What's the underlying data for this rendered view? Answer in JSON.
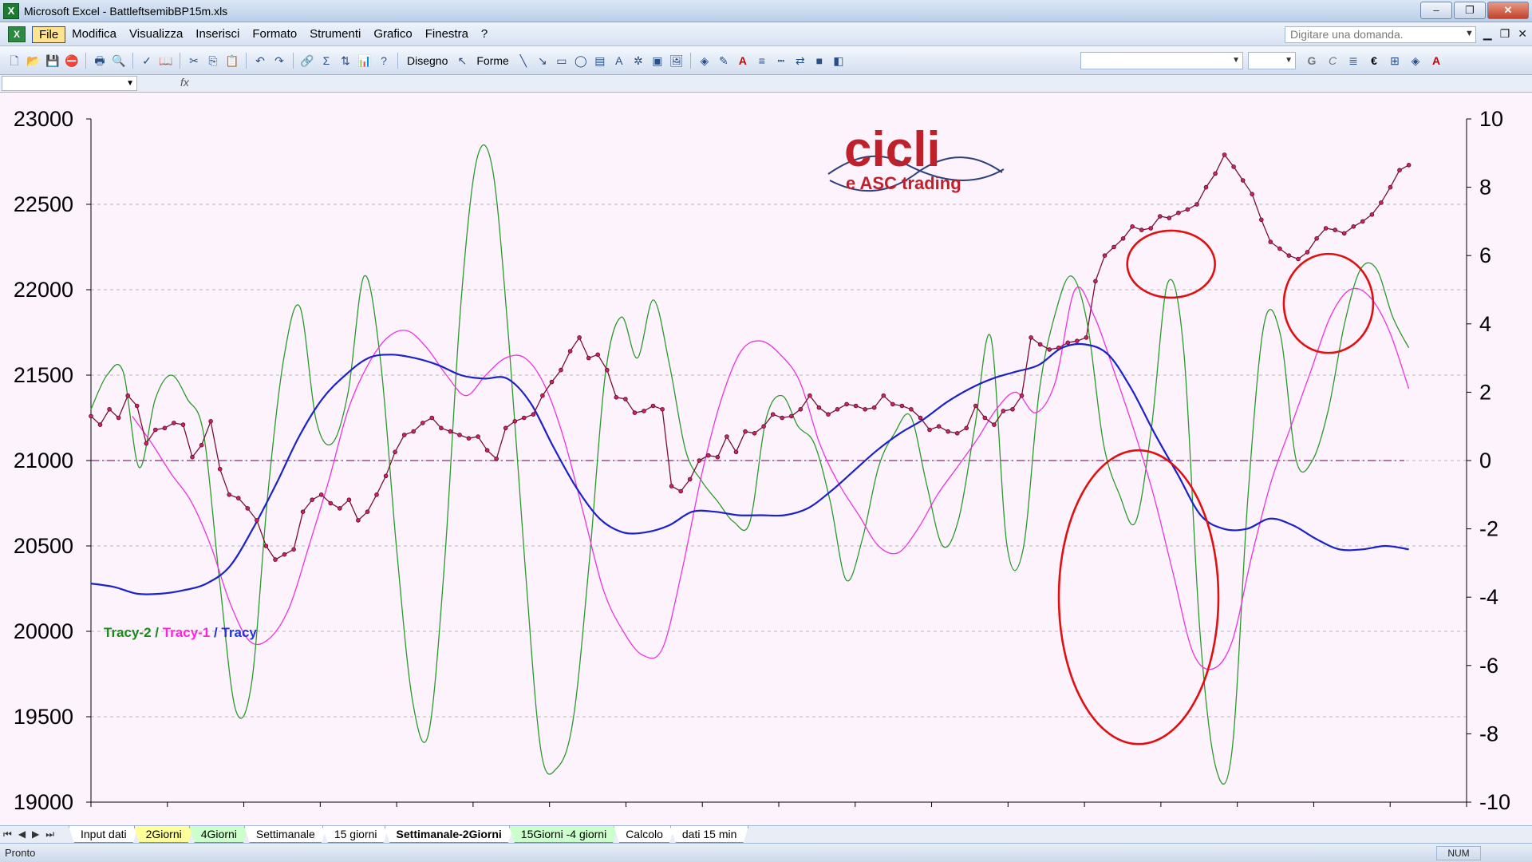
{
  "window": {
    "title": "Microsoft Excel - BattleftsemibBP15m.xls",
    "buttons": [
      "–",
      "❐",
      "✕"
    ]
  },
  "menu": {
    "items": [
      "File",
      "Modifica",
      "Visualizza",
      "Inserisci",
      "Formato",
      "Strumenti",
      "Grafico",
      "Finestra",
      "?"
    ],
    "help_placeholder": "Digitare una domanda."
  },
  "toolbar": {
    "disegno_label": "Disegno",
    "forme_label": "Forme",
    "bold": "G",
    "italic": "C",
    "euro": "€"
  },
  "formula": {
    "fx": "fx"
  },
  "logo": {
    "main": "cicli",
    "sub": "e ASC trading"
  },
  "chart_data": {
    "type": "line",
    "left_axis": {
      "ticks": [
        23000,
        22500,
        22000,
        21500,
        21000,
        20500,
        20000,
        19500,
        19000
      ],
      "ylim": [
        19000,
        23000
      ]
    },
    "right_axis": {
      "ticks": [
        10,
        8,
        6,
        4,
        2,
        0,
        -2,
        -4,
        -6,
        -8,
        -10
      ],
      "ylim": [
        -10,
        10
      ]
    },
    "legend": {
      "parts": [
        {
          "text": "Tracy-2",
          "color": "#1a8a1a"
        },
        {
          "text": " / ",
          "color": "#1a8a1a"
        },
        {
          "text": "Tracy-1",
          "color": "#ff22dd"
        },
        {
          "text": " / ",
          "color": "#2233dd"
        },
        {
          "text": "Tracy",
          "color": "#2233dd"
        }
      ]
    },
    "series": [
      {
        "name": "Price",
        "axis": "left",
        "color": "#7a1030",
        "marker_color": "#cc2266",
        "values": [
          21260,
          21210,
          21300,
          21250,
          21380,
          21320,
          21100,
          21180,
          21190,
          21220,
          21210,
          21020,
          21090,
          21230,
          20950,
          20800,
          20780,
          20720,
          20650,
          20500,
          20420,
          20450,
          20480,
          20700,
          20770,
          20800,
          20750,
          20720,
          20770,
          20650,
          20700,
          20800,
          20910,
          21050,
          21150,
          21170,
          21220,
          21250,
          21190,
          21170,
          21150,
          21130,
          21140,
          21060,
          21010,
          21190,
          21230,
          21250,
          21270,
          21380,
          21460,
          21530,
          21640,
          21720,
          21600,
          21620,
          21530,
          21370,
          21360,
          21280,
          21290,
          21320,
          21300,
          20850,
          20820,
          20890,
          21000,
          21030,
          21020,
          21140,
          21050,
          21170,
          21160,
          21200,
          21270,
          21250,
          21260,
          21300,
          21380,
          21310,
          21270,
          21300,
          21330,
          21320,
          21300,
          21310,
          21380,
          21330,
          21320,
          21300,
          21250,
          21180,
          21200,
          21170,
          21160,
          21190,
          21320,
          21250,
          21210,
          21290,
          21300,
          21380,
          21720,
          21680,
          21650,
          21660,
          21690,
          21700,
          21720,
          22050,
          22200,
          22250,
          22300,
          22370,
          22350,
          22360,
          22430,
          22420,
          22450,
          22470,
          22500,
          22600,
          22680,
          22790,
          22720,
          22640,
          22560,
          22410,
          22280,
          22240,
          22200,
          22180,
          22220,
          22300,
          22360,
          22350,
          22330,
          22370,
          22400,
          22440,
          22510,
          22600,
          22700,
          22730
        ]
      },
      {
        "name": "Tracy",
        "axis": "right",
        "color": "#1a22cc",
        "values": [
          -3.6,
          -3.7,
          -3.9,
          -3.9,
          -3.8,
          -3.6,
          -3.1,
          -2.0,
          -0.7,
          0.7,
          1.8,
          2.5,
          3.0,
          3.1,
          3.0,
          2.8,
          2.5,
          2.4,
          2.4,
          1.7,
          0.4,
          -0.8,
          -1.7,
          -2.1,
          -2.1,
          -1.9,
          -1.5,
          -1.5,
          -1.6,
          -1.6,
          -1.6,
          -1.4,
          -0.9,
          -0.3,
          0.3,
          0.8,
          1.2,
          1.7,
          2.1,
          2.4,
          2.6,
          2.8,
          3.3,
          3.4,
          3.1,
          2.1,
          0.8,
          -0.4,
          -1.6,
          -2.0,
          -2.0,
          -1.7,
          -1.9,
          -2.3,
          -2.6,
          -2.6,
          -2.5,
          -2.6
        ]
      },
      {
        "name": "Tracy-1",
        "axis": "right",
        "color": "#ee33dd",
        "values": [
          1.3,
          0.5,
          -0.4,
          -1.2,
          -2.5,
          -4.2,
          -5.3,
          -5.2,
          -4.3,
          -2.5,
          -0.6,
          1.5,
          2.8,
          3.6,
          3.8,
          3.3,
          2.5,
          1.9,
          2.5,
          3.0,
          3.0,
          2.2,
          0.6,
          -1.6,
          -3.8,
          -5.0,
          -5.7,
          -5.5,
          -3.2,
          -0.4,
          1.8,
          3.2,
          3.5,
          3.1,
          2.3,
          0.5,
          -0.7,
          -1.6,
          -2.5,
          -2.7,
          -2.0,
          -1.0,
          -0.2,
          0.6,
          1.5,
          2.0,
          1.4,
          2.3,
          5.0,
          4.2,
          2.6,
          0.9,
          -1.0,
          -3.3,
          -5.6,
          -6.1,
          -5.3,
          -2.8,
          -0.6,
          1.0,
          2.6,
          4.2,
          5.0,
          4.8,
          3.8,
          2.1
        ]
      },
      {
        "name": "Tracy-2",
        "axis": "right",
        "color": "#2a9a2a",
        "values": [
          1.5,
          2.5,
          2.6,
          -0.2,
          1.8,
          2.5,
          1.8,
          0.8,
          -3.5,
          -7.3,
          -6.5,
          -1.0,
          3.0,
          4.5,
          1.2,
          0.5,
          2.0,
          5.4,
          3.0,
          -2.5,
          -7.0,
          -8.0,
          -3.0,
          4.5,
          8.8,
          8.5,
          3.5,
          -3.0,
          -8.5,
          -9.0,
          -7.6,
          -3.0,
          2.5,
          4.2,
          3.0,
          4.7,
          2.8,
          0.3,
          -0.6,
          -1.2,
          -1.8,
          -1.8,
          1.2,
          1.9,
          1.0,
          0.5,
          -1.2,
          -3.5,
          -2.3,
          -0.2,
          0.8,
          1.3,
          -0.7,
          -2.5,
          -1.7,
          1.0,
          3.6,
          -2.5,
          -2.6,
          2.0,
          4.3,
          5.4,
          4.0,
          0.5,
          -1.0,
          -1.8,
          1.0,
          5.2,
          3.2,
          -5.0,
          -9.0,
          -8.5,
          -1.0,
          4.0,
          3.7,
          0.0,
          0.0,
          1.5,
          4.0,
          5.6,
          5.6,
          4.2,
          3.3
        ]
      }
    ],
    "reference_line": {
      "value": 0,
      "color": "#803070"
    },
    "annotations": [
      "red-circle-1",
      "red-circle-2",
      "red-circle-3"
    ]
  },
  "sheets": {
    "nav": [
      "⏮",
      "◀",
      "▶",
      "⏭"
    ],
    "tabs": [
      {
        "label": "Input dati",
        "color": "#ffffff"
      },
      {
        "label": "2Giorni",
        "color": "#ffff99"
      },
      {
        "label": "4Giorni",
        "color": "#ccffcc"
      },
      {
        "label": "Settimanale",
        "color": "#ffffff"
      },
      {
        "label": "15 giorni",
        "color": "#ffffff"
      },
      {
        "label": "Settimanale-2Giorni",
        "color": "#ffffff",
        "active": true
      },
      {
        "label": "15Giorni -4 giorni",
        "color": "#ccffcc"
      },
      {
        "label": "Calcolo",
        "color": "#ffffff"
      },
      {
        "label": "dati 15 min",
        "color": "#ffffff"
      }
    ]
  },
  "status": {
    "text": "Pronto",
    "num": "NUM"
  }
}
